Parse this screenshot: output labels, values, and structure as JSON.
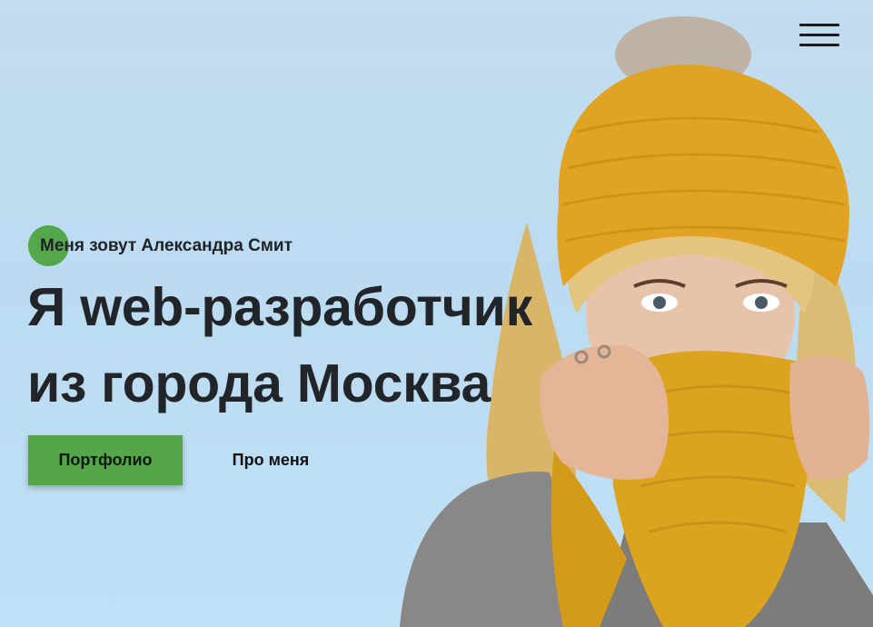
{
  "header": {
    "menu_icon": "hamburger-menu-icon"
  },
  "hero": {
    "intro": "Меня зовут Александра Смит",
    "headline_line1_prefix": "Я",
    "headline_line1_accent": "web-",
    "headline_line1_rest": "разработчик",
    "headline_line2": "из города Москва",
    "primary_button": "Портфолио",
    "secondary_button": "Про меня",
    "photo_icon": "woman-in-knit-hat-photo"
  },
  "colors": {
    "accent": "#54a64a",
    "background": "#c0ddf2",
    "text": "#212429"
  }
}
